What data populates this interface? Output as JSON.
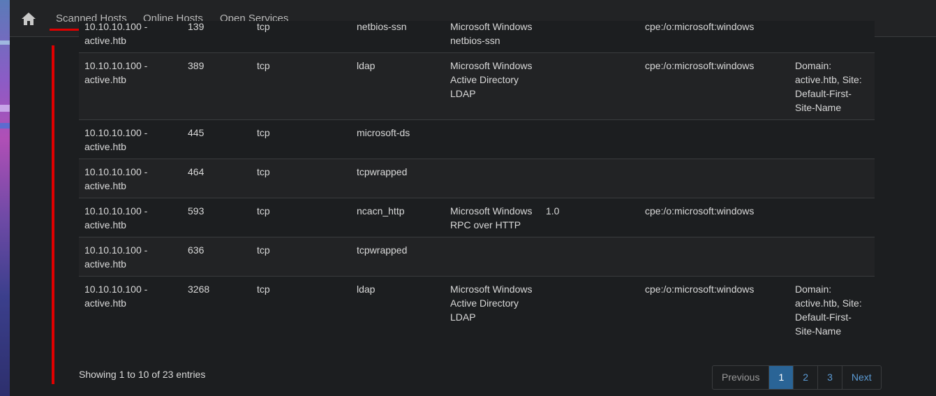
{
  "nav": {
    "items": [
      "Scanned Hosts",
      "Online Hosts",
      "Open Services"
    ]
  },
  "table": {
    "rows": [
      {
        "host": "10.10.10.100 - active.htb",
        "port": "139",
        "proto": "tcp",
        "service": "netbios-ssn",
        "product": "Microsoft Windows netbios-ssn",
        "version": "",
        "cpe": "cpe:/o:microsoft:windows",
        "extra": ""
      },
      {
        "host": "10.10.10.100 - active.htb",
        "port": "389",
        "proto": "tcp",
        "service": "ldap",
        "product": "Microsoft Windows Active Directory LDAP",
        "version": "",
        "cpe": "cpe:/o:microsoft:windows",
        "extra": "Domain: active.htb, Site: Default-First-Site-Name"
      },
      {
        "host": "10.10.10.100 - active.htb",
        "port": "445",
        "proto": "tcp",
        "service": "microsoft-ds",
        "product": "",
        "version": "",
        "cpe": "",
        "extra": ""
      },
      {
        "host": "10.10.10.100 - active.htb",
        "port": "464",
        "proto": "tcp",
        "service": "tcpwrapped",
        "product": "",
        "version": "",
        "cpe": "",
        "extra": ""
      },
      {
        "host": "10.10.10.100 - active.htb",
        "port": "593",
        "proto": "tcp",
        "service": "ncacn_http",
        "product": "Microsoft Windows RPC over HTTP",
        "version": "1.0",
        "cpe": "cpe:/o:microsoft:windows",
        "extra": ""
      },
      {
        "host": "10.10.10.100 - active.htb",
        "port": "636",
        "proto": "tcp",
        "service": "tcpwrapped",
        "product": "",
        "version": "",
        "cpe": "",
        "extra": ""
      },
      {
        "host": "10.10.10.100 - active.htb",
        "port": "3268",
        "proto": "tcp",
        "service": "ldap",
        "product": "Microsoft Windows Active Directory LDAP",
        "version": "",
        "cpe": "cpe:/o:microsoft:windows",
        "extra": "Domain: active.htb, Site: Default-First-Site-Name"
      }
    ]
  },
  "footer": {
    "info": "Showing 1 to 10 of 23 entries",
    "previous": "Previous",
    "pages": [
      "1",
      "2",
      "3"
    ],
    "next": "Next"
  },
  "icons": {
    "home": "home-icon"
  },
  "colors": {
    "accent": "#e00000",
    "active_page": "#2a6496",
    "link": "#5b9bd5"
  }
}
